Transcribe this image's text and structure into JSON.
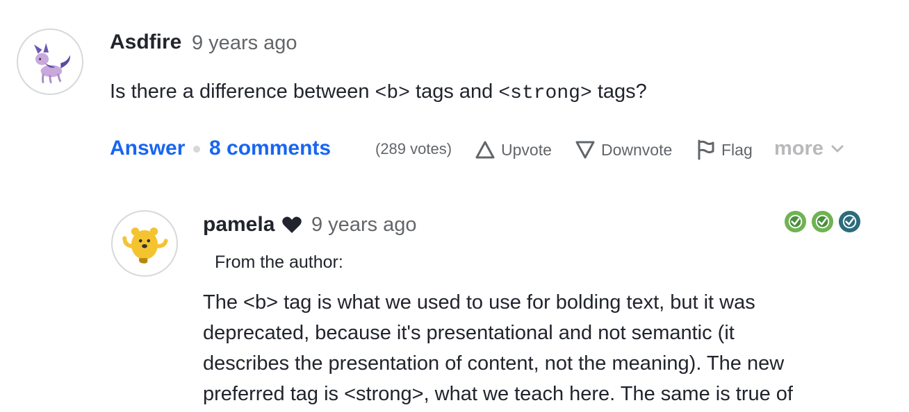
{
  "question": {
    "author": "Asdfire",
    "time": "9 years ago",
    "text_before": "Is there a difference between ",
    "code_b": "<b>",
    "text_middle": " tags and ",
    "code_strong": "<strong>",
    "text_after": " tags?",
    "avatar_icon": "purple-wolf-avatar"
  },
  "actions": {
    "answer_label": "Answer",
    "comments_label": "8 comments",
    "votes": "(289 votes)",
    "upvote_label": "Upvote",
    "downvote_label": "Downvote",
    "flag_label": "Flag",
    "more_label": "more"
  },
  "answer": {
    "author": "pamela",
    "time": "9 years ago",
    "from_author": "From the author:",
    "avatar_icon": "yellow-creature-avatar",
    "lines": [
      "The <b> tag is what we used to use for bolding text, but it was",
      "deprecated, because it's presentational and not semantic (it",
      "describes the presentation of content, not the meaning). The new",
      "preferred tag is <strong>, what we teach here. The same is true of"
    ]
  },
  "colors": {
    "link": "#1865f2",
    "muted": "#626569",
    "text": "#21242c",
    "badge_green": "#6fb352",
    "badge_teal": "#2b6c7b"
  }
}
